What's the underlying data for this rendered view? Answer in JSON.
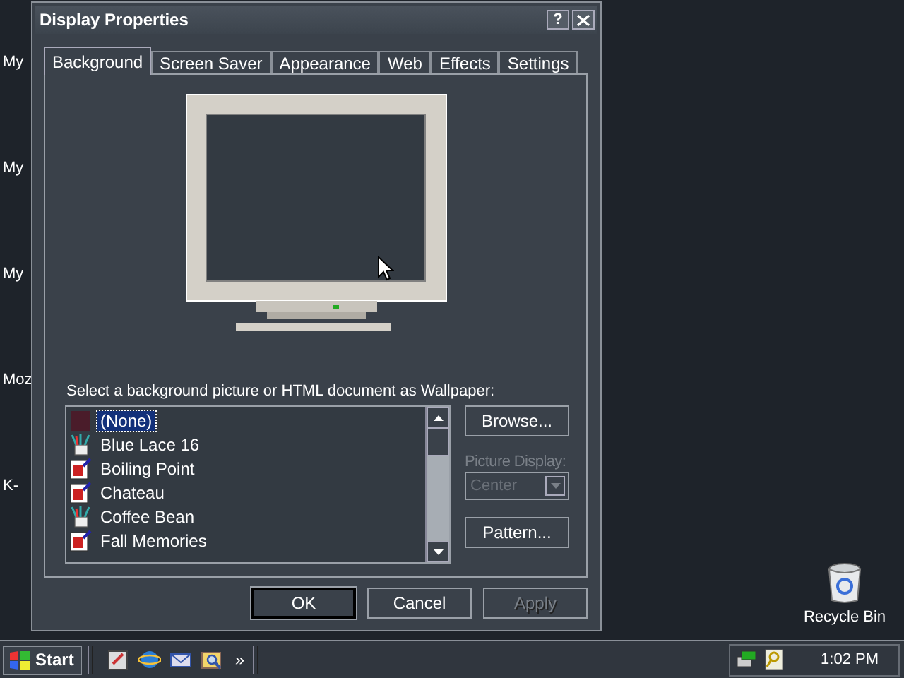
{
  "desktop": {
    "icons": [
      {
        "label": "My"
      },
      {
        "label": "My"
      },
      {
        "label": "My"
      },
      {
        "label": "Moz"
      },
      {
        "label": "K-"
      }
    ],
    "recycle_bin": {
      "label": "Recycle Bin"
    }
  },
  "window": {
    "title": "Display Properties",
    "help_button": "?"
  },
  "tabs": [
    {
      "label": "Background",
      "selected": true
    },
    {
      "label": "Screen Saver",
      "selected": false
    },
    {
      "label": "Appearance",
      "selected": false
    },
    {
      "label": "Web",
      "selected": false
    },
    {
      "label": "Effects",
      "selected": false
    },
    {
      "label": "Settings",
      "selected": false
    }
  ],
  "wallpaper": {
    "label": "Select a background picture or HTML document as Wallpaper:",
    "items": [
      {
        "name": "(None)",
        "kind": "none",
        "selected": true
      },
      {
        "name": "Blue Lace 16",
        "kind": "picture",
        "selected": false
      },
      {
        "name": "Boiling Point",
        "kind": "html",
        "selected": false
      },
      {
        "name": "Chateau",
        "kind": "html",
        "selected": false
      },
      {
        "name": "Coffee Bean",
        "kind": "picture",
        "selected": false
      },
      {
        "name": "Fall Memories",
        "kind": "html",
        "selected": false
      }
    ]
  },
  "browse_button": "Browse...",
  "picture_display": {
    "label": "Picture Display:",
    "value": "Center",
    "disabled": true
  },
  "pattern_button": "Pattern...",
  "buttons": [
    {
      "label": "OK",
      "disabled": false
    },
    {
      "label": "Cancel",
      "disabled": false
    },
    {
      "label": "Apply",
      "disabled": true
    }
  ],
  "taskbar": {
    "start": "Start",
    "more": "»",
    "clock": "1:02 PM"
  }
}
